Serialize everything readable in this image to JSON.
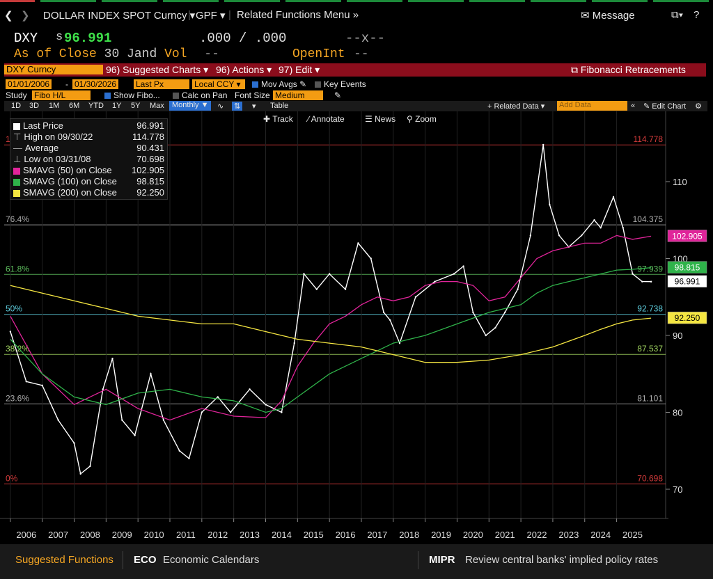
{
  "nav": {
    "security": "DOLLAR INDEX SPOT Curncy",
    "gpf": "GPF",
    "related": "Related Functions Menu",
    "message": "Message"
  },
  "header": {
    "ticker": "DXY",
    "price_prefix": "s",
    "price": "96.991",
    "bidask": ".000 / .000",
    "size": "--x--",
    "asof": "As of Close",
    "date": "30 Jand",
    "vol_label": "Vol",
    "vol": "--",
    "oi_label": "OpenInt",
    "oi": "--"
  },
  "redbar": {
    "ticker_box": "DXY Curncy",
    "suggested": "96) Suggested Charts",
    "actions": "96) Actions",
    "edit": "97) Edit",
    "title": "Fibonacci Retracements"
  },
  "controls": {
    "start": "01/01/2006",
    "end": "01/30/2026",
    "field": "Last Px",
    "ccy": "Local CCY",
    "mov_avgs": "Mov Avgs",
    "key_events": "Key Events",
    "study_label": "Study",
    "study": "Fibo H/L",
    "show_fibo": "Show Fibo...",
    "calc_on_pan": "Calc on Pan",
    "font_size_label": "Font Size",
    "font_size": "Medium"
  },
  "rangebar": {
    "buttons": [
      "1D",
      "3D",
      "1M",
      "6M",
      "YTD",
      "1Y",
      "5Y",
      "Max"
    ],
    "period": "Monthly",
    "table": "Table",
    "related_data": "Related Data",
    "add_data": "Add Data",
    "edit_chart": "Edit Chart"
  },
  "chart_tools": {
    "track": "Track",
    "annotate": "Annotate",
    "news": "News",
    "zoom": "Zoom"
  },
  "legend": [
    {
      "label": "Last Price",
      "value": "96.991",
      "color": "#ffffff"
    },
    {
      "label": "High on 09/30/22",
      "value": "114.778",
      "color": ""
    },
    {
      "label": "Average",
      "value": "90.431",
      "color": ""
    },
    {
      "label": "Low on 03/31/08",
      "value": "70.698",
      "color": ""
    },
    {
      "label": "SMAVG (50)  on Close",
      "value": "102.905",
      "color": "#e0249a"
    },
    {
      "label": "SMAVG (100)  on Close",
      "value": "98.815",
      "color": "#2fb34a"
    },
    {
      "label": "SMAVG (200)  on Close",
      "value": "92.250",
      "color": "#f5e642"
    }
  ],
  "chart_data": {
    "type": "line",
    "title": "",
    "x_ticks": [
      "2006",
      "2007",
      "2008",
      "2009",
      "2010",
      "2011",
      "2012",
      "2013",
      "2014",
      "2015",
      "2016",
      "2017",
      "2018",
      "2019",
      "2020",
      "2021",
      "2022",
      "2023",
      "2024",
      "2025"
    ],
    "ylim": [
      67,
      117
    ],
    "y_ticks": [
      70,
      80,
      90,
      100,
      110
    ],
    "fib_levels": [
      {
        "label": "100%",
        "value": 114.778,
        "value_label": "114.778",
        "color": "#d43b3b"
      },
      {
        "label": "76.4%",
        "value": 104.375,
        "value_label": "104.375",
        "color": "#aaaaaa"
      },
      {
        "label": "61.8%",
        "value": 97.939,
        "value_label": "97.939",
        "color": "#5fbf5f"
      },
      {
        "label": "50%",
        "value": 92.738,
        "value_label": "92.738",
        "color": "#5fd0e0"
      },
      {
        "label": "38.2%",
        "value": 87.537,
        "value_label": "87.537",
        "color": "#9fd35f"
      },
      {
        "label": "23.6%",
        "value": 81.101,
        "value_label": "81.101",
        "color": "#aaaaaa"
      },
      {
        "label": "0%",
        "value": 70.698,
        "value_label": "70.698",
        "color": "#d43b3b"
      }
    ],
    "series": [
      {
        "name": "Last Price",
        "color": "#ffffff",
        "x": [
          2006.0,
          2006.5,
          2007.0,
          2007.5,
          2008.0,
          2008.2,
          2008.5,
          2008.9,
          2009.2,
          2009.5,
          2009.9,
          2010.4,
          2010.8,
          2011.3,
          2011.6,
          2012.0,
          2012.5,
          2012.9,
          2013.5,
          2014.0,
          2014.5,
          2014.9,
          2015.2,
          2015.6,
          2016.0,
          2016.5,
          2016.9,
          2017.3,
          2017.7,
          2017.9,
          2018.2,
          2018.7,
          2019.3,
          2019.9,
          2020.2,
          2020.5,
          2020.9,
          2021.2,
          2021.5,
          2021.9,
          2022.3,
          2022.7,
          2022.9,
          2023.2,
          2023.5,
          2023.9,
          2024.3,
          2024.5,
          2024.9,
          2025.2,
          2025.5,
          2025.8,
          2026.08
        ],
        "y": [
          90.5,
          84.0,
          83.5,
          79.0,
          76.0,
          72.0,
          73.0,
          83.0,
          87.0,
          79.0,
          77.0,
          85.0,
          79.0,
          75.0,
          74.0,
          80.0,
          82.0,
          80.0,
          83.0,
          81.0,
          80.0,
          89.0,
          98.0,
          96.0,
          98.0,
          96.0,
          102.0,
          100.0,
          93.0,
          92.0,
          89.0,
          95.0,
          97.0,
          98.0,
          99.0,
          93.0,
          90.0,
          91.0,
          93.0,
          96.0,
          103.0,
          114.8,
          107.0,
          103.0,
          101.5,
          103.0,
          105.0,
          104.0,
          108.0,
          104.0,
          98.0,
          97.0,
          96.991
        ]
      },
      {
        "name": "SMAVG (50)",
        "color": "#e0249a",
        "x": [
          2006.0,
          2007.0,
          2008.0,
          2009.0,
          2010.0,
          2011.0,
          2012.0,
          2013.0,
          2014.0,
          2014.5,
          2015.0,
          2015.5,
          2016.0,
          2016.5,
          2017.0,
          2017.5,
          2018.0,
          2018.5,
          2019.0,
          2019.5,
          2020.0,
          2020.5,
          2021.0,
          2021.5,
          2022.0,
          2022.5,
          2023.0,
          2023.5,
          2024.0,
          2024.5,
          2025.0,
          2025.5,
          2026.08
        ],
        "y": [
          92.5,
          85.0,
          81.0,
          83.0,
          80.5,
          79.0,
          80.5,
          79.5,
          79.3,
          81.5,
          86.0,
          89.0,
          91.5,
          92.5,
          94.0,
          95.0,
          94.5,
          95.0,
          96.5,
          97.0,
          97.0,
          96.5,
          94.5,
          95.0,
          97.5,
          100.0,
          101.0,
          101.5,
          102.0,
          102.0,
          103.0,
          102.5,
          102.905
        ]
      },
      {
        "name": "SMAVG (100)",
        "color": "#2fb34a",
        "x": [
          2006.0,
          2007.0,
          2008.0,
          2009.0,
          2010.0,
          2011.0,
          2012.0,
          2013.0,
          2014.0,
          2014.5,
          2015.0,
          2016.0,
          2017.0,
          2018.0,
          2019.0,
          2020.0,
          2021.0,
          2022.0,
          2022.5,
          2023.0,
          2023.5,
          2024.0,
          2024.5,
          2025.0,
          2025.5,
          2026.08
        ],
        "y": [
          89.5,
          85.0,
          82.0,
          81.0,
          82.5,
          83.0,
          82.0,
          81.5,
          80.0,
          80.5,
          82.0,
          85.0,
          87.0,
          89.0,
          90.0,
          91.5,
          93.0,
          94.0,
          95.5,
          96.5,
          97.0,
          97.5,
          98.0,
          98.5,
          98.6,
          98.815
        ]
      },
      {
        "name": "SMAVG (200)",
        "color": "#f5e642",
        "x": [
          2006.0,
          2007.0,
          2008.0,
          2009.0,
          2010.0,
          2011.0,
          2012.0,
          2013.0,
          2014.0,
          2015.0,
          2016.0,
          2017.0,
          2018.0,
          2019.0,
          2020.0,
          2021.0,
          2022.0,
          2023.0,
          2024.0,
          2024.5,
          2025.0,
          2025.5,
          2026.08
        ],
        "y": [
          96.5,
          95.5,
          94.5,
          93.5,
          92.5,
          92.0,
          91.5,
          91.5,
          90.5,
          89.5,
          89.0,
          88.5,
          87.5,
          86.5,
          86.5,
          86.8,
          87.5,
          88.5,
          90.0,
          90.8,
          91.5,
          92.0,
          92.25
        ]
      }
    ],
    "last_labels": [
      {
        "value": 102.905,
        "label": "102.905",
        "color": "#e0249a"
      },
      {
        "value": 98.815,
        "label": "98.815",
        "color": "#2fb34a"
      },
      {
        "value": 96.991,
        "label": "96.991",
        "color": "#ffffff"
      },
      {
        "value": 92.25,
        "label": "92.250",
        "color": "#f5e642"
      }
    ],
    "grid": false
  },
  "footer": {
    "suggested": "Suggested Functions",
    "eco_code": "ECO",
    "eco_label": "Economic Calendars",
    "mipr_code": "MIPR",
    "mipr_label": "Review central banks' implied policy rates"
  }
}
